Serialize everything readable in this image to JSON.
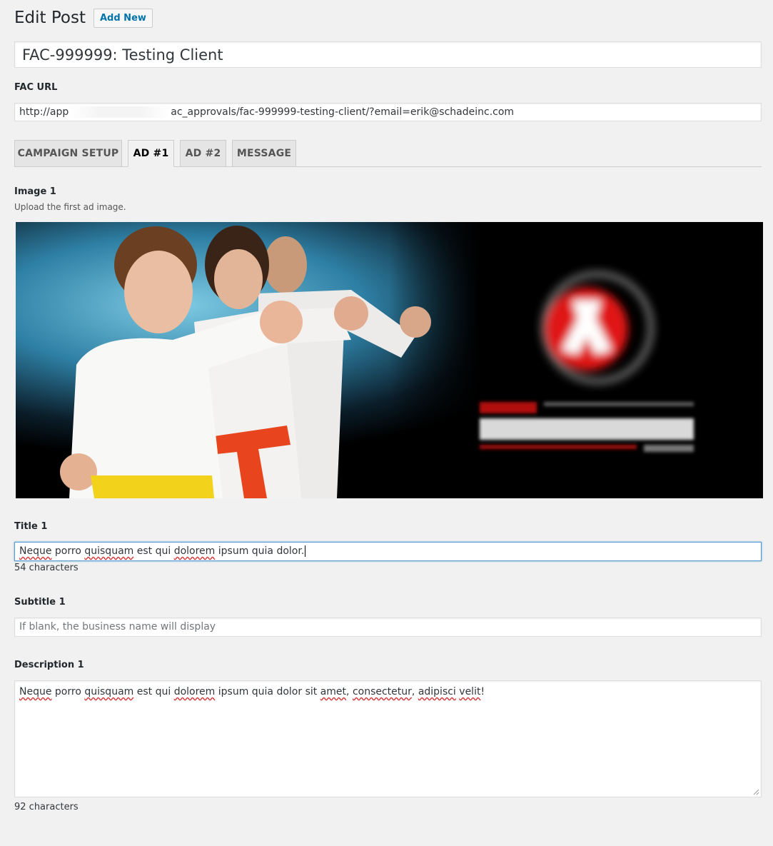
{
  "header": {
    "title": "Edit Post",
    "add_new": "Add New"
  },
  "post_title": "FAC-999999: Testing Client",
  "fac_url": {
    "label": "FAC URL",
    "value_start": "http://app",
    "value_end": "ac_approvals/fac-999999-testing-client/?email=erik@schadeinc.com"
  },
  "tabs": [
    {
      "label": "CAMPAIGN SETUP",
      "active": false
    },
    {
      "label": "AD #1",
      "active": true
    },
    {
      "label": "AD #2",
      "active": false
    },
    {
      "label": "MESSAGE",
      "active": false
    }
  ],
  "image1": {
    "label": "Image 1",
    "description": "Upload the first ad image.",
    "image_name": "martial-arts-kids-ad-image"
  },
  "title1": {
    "label": "Title 1",
    "value_parts": [
      "Neque",
      " porro ",
      "quisquam",
      " est qui ",
      "dolorem",
      " ipsum quia dolor."
    ],
    "count": "54 characters"
  },
  "subtitle1": {
    "label": "Subtitle 1",
    "placeholder": "If blank, the business name will display"
  },
  "description1": {
    "label": "Description 1",
    "value_parts": [
      "Neque",
      " porro ",
      "quisquam",
      " est qui ",
      "dolorem",
      " ipsum quia dolor sit ",
      "amet",
      ", ",
      "consectetur",
      ", ",
      "adipisci",
      " ",
      "velit",
      "!"
    ],
    "count": "92 characters"
  },
  "colors": {
    "link": "#0073aa",
    "focus_border": "#5b9dd9",
    "spellcheck": "#d63638"
  }
}
